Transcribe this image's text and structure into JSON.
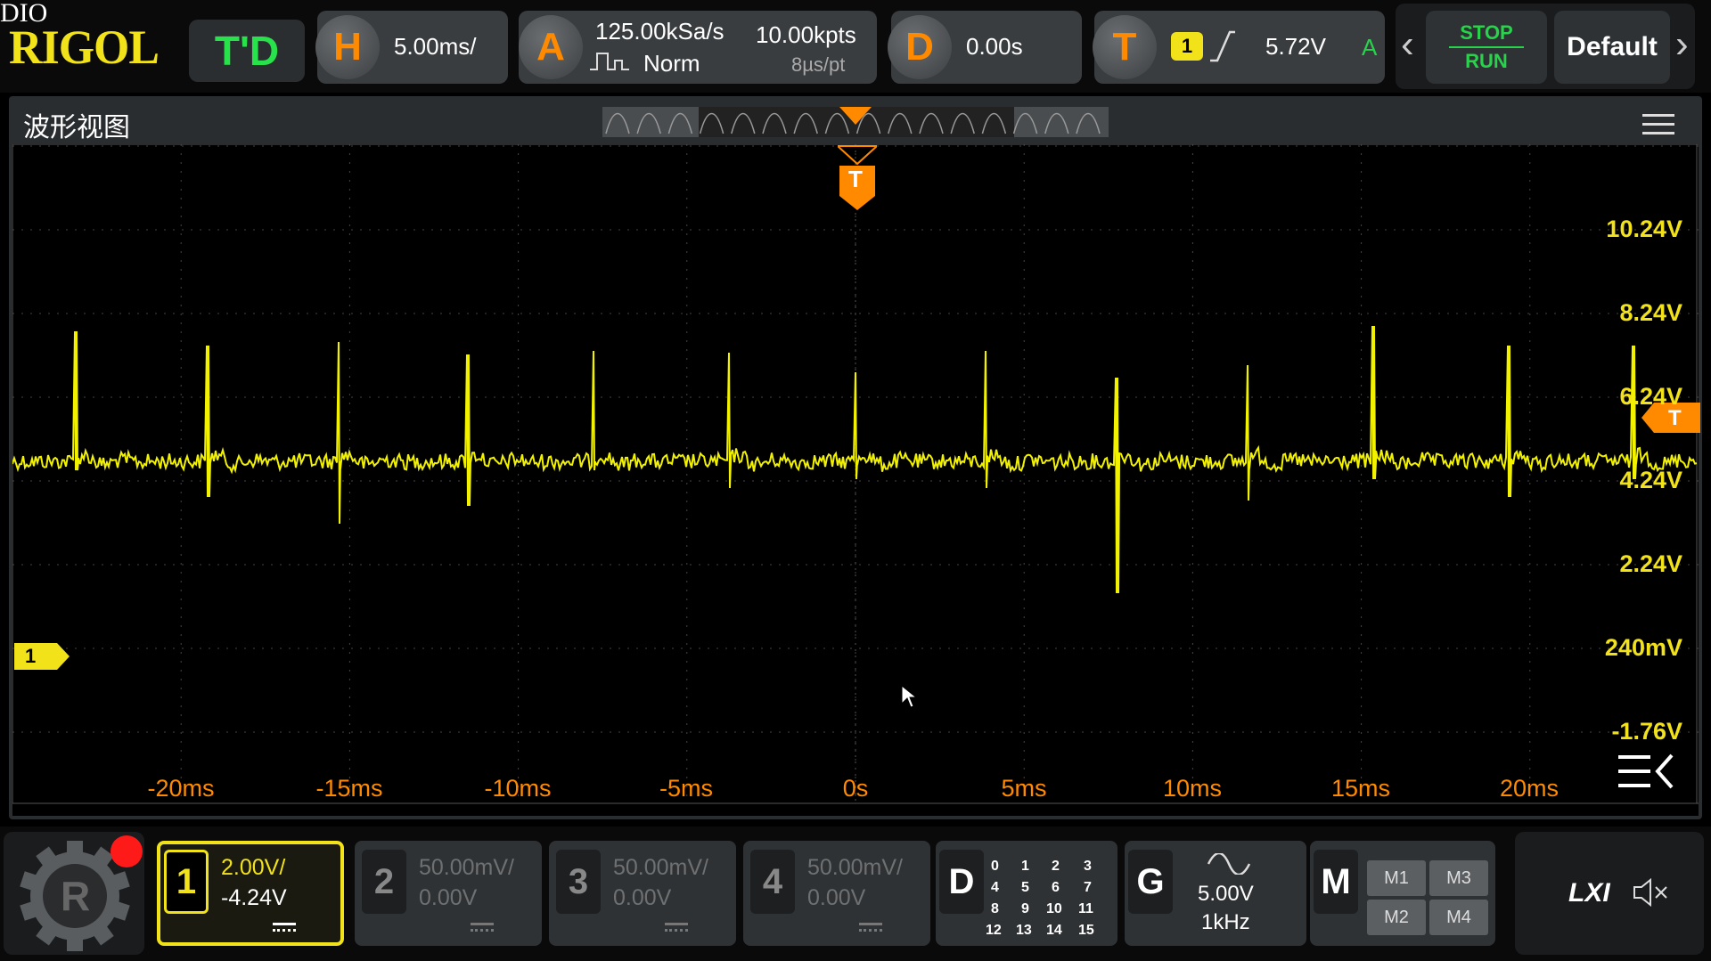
{
  "overlay_text": "DIO",
  "brand": "RIGOL",
  "mode": "T'D",
  "horizontal": {
    "label": "H",
    "scale": "5.00ms/"
  },
  "acquire": {
    "label": "A",
    "sample_rate": "125.00kSa/s",
    "points": "10.00kpts",
    "mode": "Norm",
    "resolution": "8µs/pt"
  },
  "delay": {
    "label": "D",
    "value": "0.00s"
  },
  "trigger": {
    "label": "T",
    "channel": "1",
    "level": "5.72V",
    "mode": "A"
  },
  "stop_run": {
    "stop": "STOP",
    "run": "RUN"
  },
  "default_button": "Default",
  "window_title": "波形视图",
  "trigger_marker": "T",
  "channel_marker": "1",
  "y_labels": [
    "10.24V",
    "8.24V",
    "6.24V",
    "4.24V",
    "2.24V",
    "240mV",
    "-1.76V"
  ],
  "x_labels": [
    "-20ms",
    "-15ms",
    "-10ms",
    "-5ms",
    "0s",
    "5ms",
    "10ms",
    "15ms",
    "20ms"
  ],
  "channels": [
    {
      "num": "1",
      "scale": "2.00V/",
      "offset": "-4.24V",
      "active": true,
      "color": "#f2f200"
    },
    {
      "num": "2",
      "scale": "50.00mV/",
      "offset": "0.00V",
      "active": false
    },
    {
      "num": "3",
      "scale": "50.00mV/",
      "offset": "0.00V",
      "active": false
    },
    {
      "num": "4",
      "scale": "50.00mV/",
      "offset": "0.00V",
      "active": false
    }
  ],
  "digital": {
    "label": "D",
    "bits": [
      "0",
      "1",
      "2",
      "3",
      "4",
      "5",
      "6",
      "7",
      "8",
      "9",
      "10",
      "11",
      "12",
      "13",
      "14",
      "15"
    ]
  },
  "generator": {
    "label": "G",
    "amplitude": "5.00V",
    "frequency": "1kHz"
  },
  "math": {
    "label": "M",
    "items": [
      "M1",
      "M3",
      "M2",
      "M4"
    ]
  },
  "lxi": "LXI",
  "colors": {
    "trace": "#f2f200",
    "trigger": "#ff8a00",
    "run_green": "#27d34a"
  }
}
